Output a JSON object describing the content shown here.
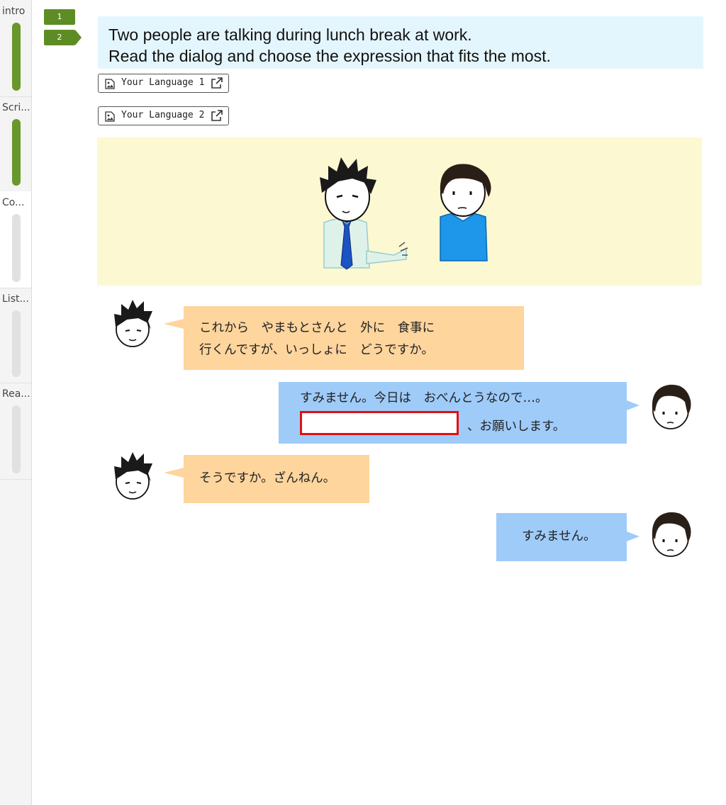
{
  "sidebar": {
    "sections": [
      {
        "label": "intro",
        "done": true
      },
      {
        "label": "Scri...",
        "done": true
      },
      {
        "label": "Co...",
        "done": false
      },
      {
        "label": "List...",
        "done": false
      },
      {
        "label": "Rea...",
        "done": false
      }
    ]
  },
  "steps": [
    {
      "label": "1",
      "current": false
    },
    {
      "label": "2",
      "current": true
    }
  ],
  "instruction": {
    "line1": "Two people are talking during lunch break at work.",
    "line2": "Read the dialog and choose the expression that fits the most."
  },
  "language_links": [
    {
      "label": "Your Language 1"
    },
    {
      "label": "Your Language 2"
    }
  ],
  "dialog": [
    {
      "speaker": "left",
      "lines": [
        "これから　やまもとさんと　外に　食事に",
        "行くんですが、いっしょに　どうですか。"
      ]
    },
    {
      "speaker": "right",
      "lines": [
        "すみません。今日は　おべんとうなので…。"
      ],
      "blank_suffix": "、お願いします。"
    },
    {
      "speaker": "left",
      "lines": [
        "そうですか。ざんねん。"
      ]
    },
    {
      "speaker": "right",
      "lines": [
        "すみません。"
      ]
    }
  ],
  "colors": {
    "accent_green": "#5e8c24",
    "instruction_bg": "#e4f6fd",
    "scene_bg": "#fcf8d2",
    "bubble_left": "#fdd59d",
    "bubble_right": "#9fcbf9",
    "blank_border": "#e01010"
  }
}
